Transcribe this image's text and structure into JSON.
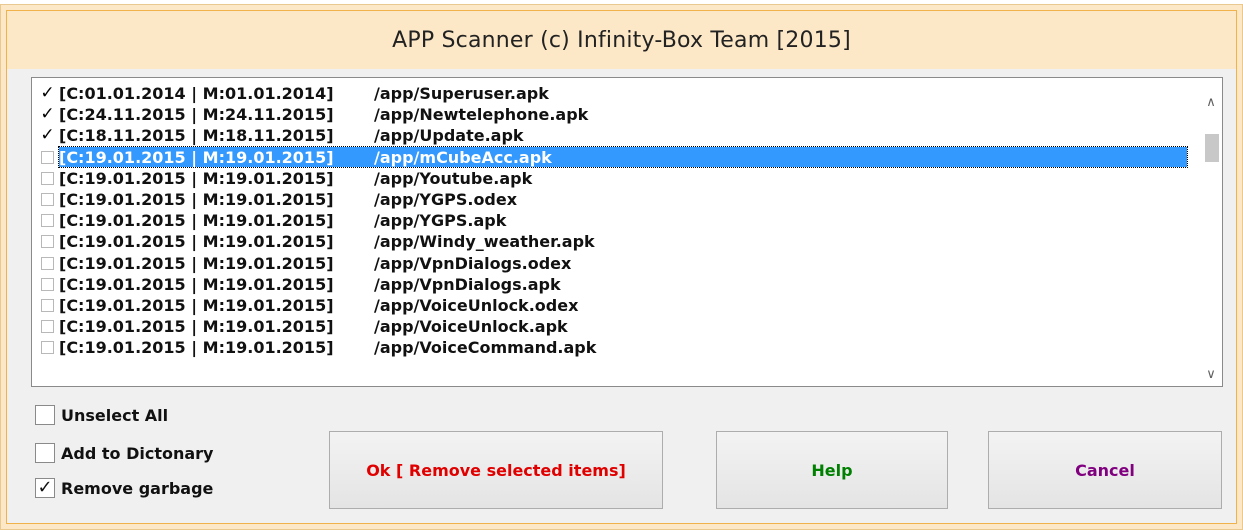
{
  "window": {
    "title": "APP Scanner (c) Infinity-Box Team [2015]"
  },
  "list": {
    "items": [
      {
        "checked": true,
        "date": "[C:01.01.2014 | M:01.01.2014]",
        "path": "/app/Superuser.apk"
      },
      {
        "checked": true,
        "date": "[C:24.11.2015 | M:24.11.2015]",
        "path": "/app/Newtelephone.apk"
      },
      {
        "checked": true,
        "date": "[C:18.11.2015 | M:18.11.2015]",
        "path": "/app/Update.apk"
      },
      {
        "checked": false,
        "date": "[C:19.01.2015 | M:19.01.2015]",
        "path": "/app/mCubeAcc.apk",
        "selected": true
      },
      {
        "checked": false,
        "date": "[C:19.01.2015 | M:19.01.2015]",
        "path": "/app/Youtube.apk"
      },
      {
        "checked": false,
        "date": "[C:19.01.2015 | M:19.01.2015]",
        "path": "/app/YGPS.odex"
      },
      {
        "checked": false,
        "date": "[C:19.01.2015 | M:19.01.2015]",
        "path": "/app/YGPS.apk"
      },
      {
        "checked": false,
        "date": "[C:19.01.2015 | M:19.01.2015]",
        "path": "/app/Windy_weather.apk"
      },
      {
        "checked": false,
        "date": "[C:19.01.2015 | M:19.01.2015]",
        "path": "/app/VpnDialogs.odex"
      },
      {
        "checked": false,
        "date": "[C:19.01.2015 | M:19.01.2015]",
        "path": "/app/VpnDialogs.apk"
      },
      {
        "checked": false,
        "date": "[C:19.01.2015 | M:19.01.2015]",
        "path": "/app/VoiceUnlock.odex"
      },
      {
        "checked": false,
        "date": "[C:19.01.2015 | M:19.01.2015]",
        "path": "/app/VoiceUnlock.apk"
      },
      {
        "checked": false,
        "date": "[C:19.01.2015 | M:19.01.2015]",
        "path": "/app/VoiceCommand.apk"
      }
    ],
    "scroll_up_icon": "chevron-up-icon",
    "scroll_down_icon": "chevron-down-icon"
  },
  "options": {
    "unselect_all": {
      "label": "Unselect All",
      "checked": false
    },
    "add_to_dictionary": {
      "label": "Add to Dictonary",
      "checked": false
    },
    "remove_garbage": {
      "label": "Remove garbage",
      "checked": true
    }
  },
  "buttons": {
    "ok": {
      "label": "Ok [ Remove selected items]",
      "color": "#e00000"
    },
    "help": {
      "label": "Help",
      "color": "#008000"
    },
    "cancel": {
      "label": "Cancel",
      "color": "#800080"
    }
  },
  "colors": {
    "title_bar": "#fce8c7",
    "selection": "#3399ff",
    "dialog_bg": "#f0f0f0"
  }
}
